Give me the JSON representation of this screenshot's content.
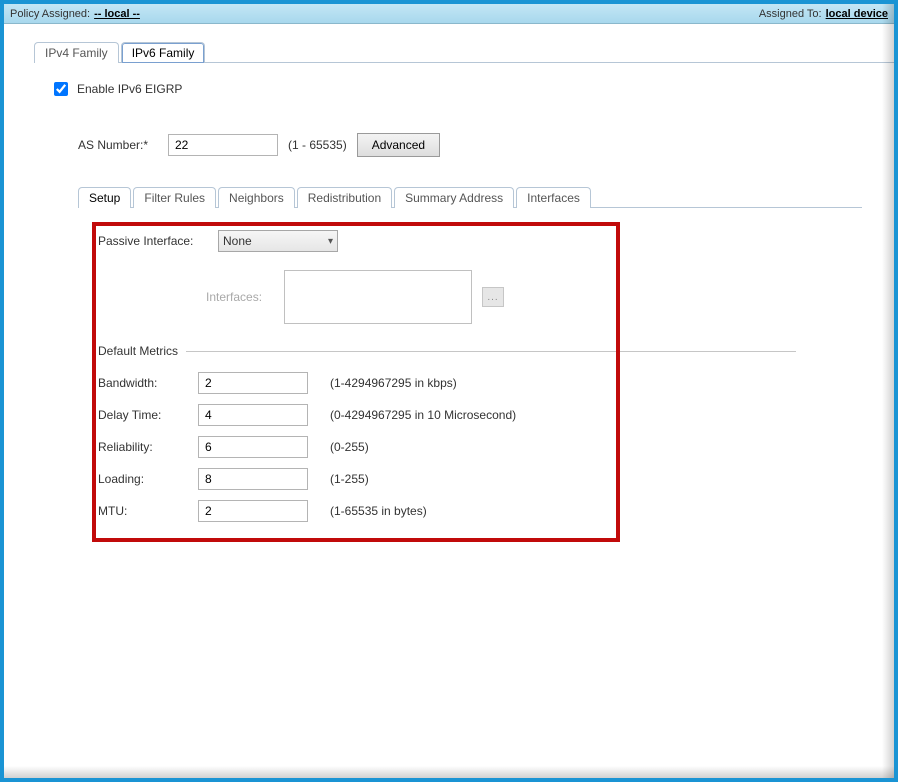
{
  "header": {
    "policy_label": "Policy Assigned:",
    "policy_value": "-- local --",
    "assigned_label": "Assigned To:",
    "assigned_value": "local device"
  },
  "topTabs": [
    {
      "label": "IPv4 Family",
      "active": false
    },
    {
      "label": "IPv6 Family",
      "active": true
    }
  ],
  "enable_checkbox": {
    "label": "Enable IPv6 EIGRP",
    "checked": true
  },
  "as_number": {
    "label": "AS Number:",
    "value": "22",
    "hint": "(1 - 65535)",
    "advanced_btn": "Advanced"
  },
  "innerTabs": [
    {
      "label": "Setup",
      "active": true
    },
    {
      "label": "Filter Rules",
      "active": false
    },
    {
      "label": "Neighbors",
      "active": false
    },
    {
      "label": "Redistribution",
      "active": false
    },
    {
      "label": "Summary Address",
      "active": false
    },
    {
      "label": "Interfaces",
      "active": false
    }
  ],
  "passive_interface": {
    "label": "Passive Interface:",
    "selected": "None"
  },
  "interfaces_field": {
    "label": "Interfaces:"
  },
  "default_metrics": {
    "heading": "Default Metrics",
    "rows": [
      {
        "label": "Bandwidth:",
        "value": "2",
        "hint": "(1-4294967295 in kbps)"
      },
      {
        "label": "Delay Time:",
        "value": "4",
        "hint": "(0-4294967295 in 10 Microsecond)"
      },
      {
        "label": "Reliability:",
        "value": "6",
        "hint": "(0-255)"
      },
      {
        "label": "Loading:",
        "value": "8",
        "hint": "(1-255)"
      },
      {
        "label": "MTU:",
        "value": "2",
        "hint": "(1-65535 in bytes)"
      }
    ]
  }
}
